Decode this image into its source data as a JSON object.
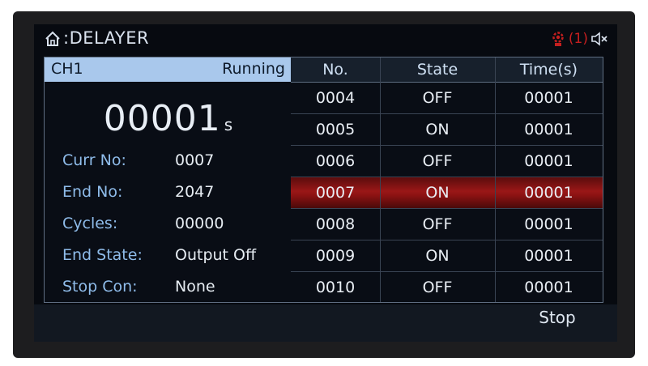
{
  "header": {
    "title": ":DELAYER",
    "alarm_count": "(1)",
    "icons": {
      "home": "home-icon",
      "alarm": "gear-alarm-icon",
      "sound": "mute-icon"
    }
  },
  "channel": {
    "name": "CH1",
    "state": "Running",
    "time_value": "00001",
    "time_unit": "s"
  },
  "info": [
    {
      "label": "Curr No:",
      "value": "0007"
    },
    {
      "label": "End No:",
      "value": "2047"
    },
    {
      "label": "Cycles:",
      "value": "00000"
    },
    {
      "label": "End State:",
      "value": "Output Off"
    },
    {
      "label": "Stop Con:",
      "value": "None"
    }
  ],
  "table": {
    "headers": [
      "No.",
      "State",
      "Time(s)"
    ],
    "rows": [
      {
        "no": "0004",
        "state": "OFF",
        "time": "00001"
      },
      {
        "no": "0005",
        "state": "ON",
        "time": "00001"
      },
      {
        "no": "0006",
        "state": "OFF",
        "time": "00001"
      },
      {
        "no": "0007",
        "state": "ON",
        "time": "00001"
      },
      {
        "no": "0008",
        "state": "OFF",
        "time": "00001"
      },
      {
        "no": "0009",
        "state": "ON",
        "time": "00001"
      },
      {
        "no": "0010",
        "state": "OFF",
        "time": "00001"
      }
    ],
    "selected_no": "0007"
  },
  "softkeys": [
    "",
    "",
    "",
    "",
    "Stop"
  ],
  "colors": {
    "accent": "#a9c8ec",
    "label": "#8fbcea",
    "selected_row": "#9a1717",
    "alarm": "#c41f1f"
  }
}
